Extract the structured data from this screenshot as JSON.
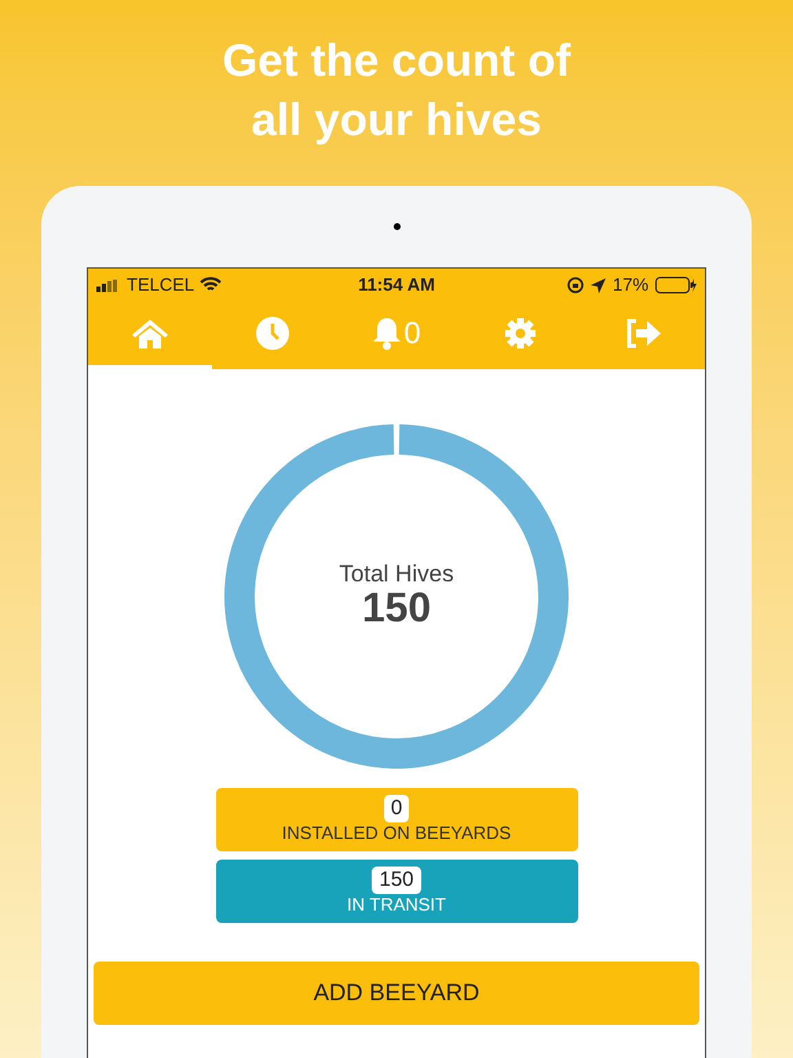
{
  "headline": [
    "Get the count of",
    "all your hives"
  ],
  "status_bar": {
    "carrier": "TELCEL",
    "time": "11:54 AM",
    "battery": "17%"
  },
  "tabs": [
    {
      "kind": "home",
      "selected": true
    },
    {
      "kind": "clock",
      "selected": false
    },
    {
      "kind": "bell",
      "selected": false,
      "count": "0"
    },
    {
      "kind": "gear",
      "selected": false
    },
    {
      "kind": "logout",
      "selected": false
    }
  ],
  "donut": {
    "label": "Total Hives",
    "value": "150"
  },
  "counts": [
    {
      "value": "0",
      "label": "INSTALLED ON BEEYARDS",
      "color": "#fbbf0b"
    },
    {
      "value": "150",
      "label": "IN TRANSIT",
      "color": "#18a3ba"
    }
  ],
  "action_button": "ADD BEEYARD"
}
